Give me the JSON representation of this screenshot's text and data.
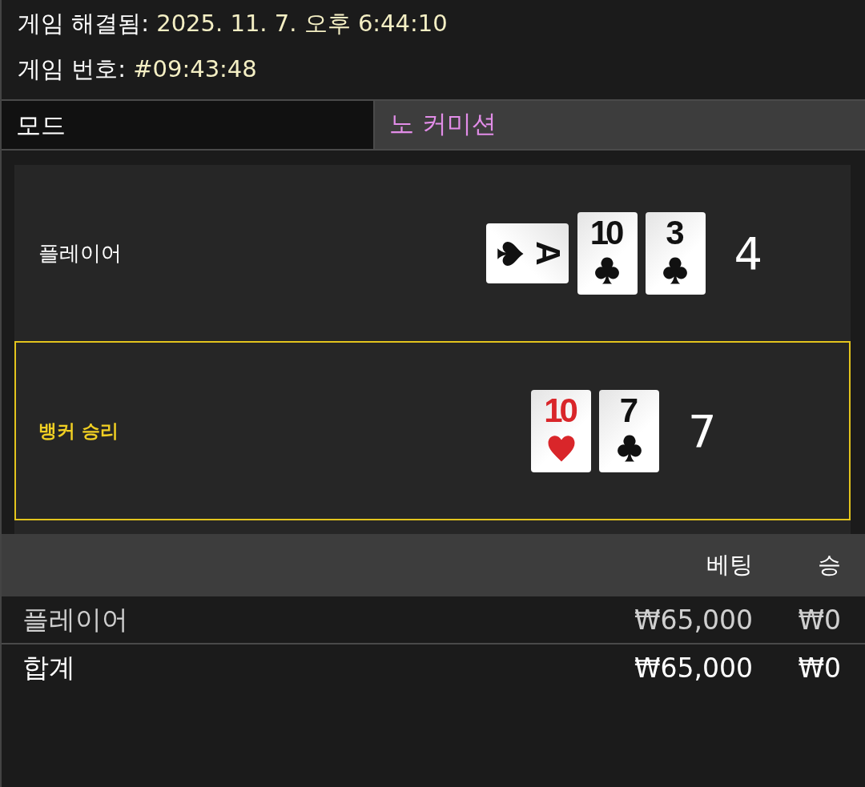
{
  "header": [
    {
      "label": "게임 해결됨:",
      "value": "2025. 11. 7. 오후 6:44:10"
    },
    {
      "label": "게임 번호:",
      "value": "#09:43:48"
    }
  ],
  "mode": {
    "label": "모드",
    "value": "노 커미션"
  },
  "hands": [
    {
      "label": "플레이어",
      "winner": false,
      "score": "4",
      "cards": [
        {
          "rank": "A",
          "kind": "spade",
          "rotated": true
        },
        {
          "rank": "10",
          "kind": "club",
          "rotated": false
        },
        {
          "rank": "3",
          "kind": "club",
          "rotated": false
        }
      ]
    },
    {
      "label": "뱅커 승리",
      "winner": true,
      "score": "7",
      "cards": [
        {
          "rank": "10",
          "kind": "heart",
          "rotated": false
        },
        {
          "rank": "7",
          "kind": "club",
          "rotated": false
        }
      ]
    }
  ],
  "bets": {
    "columns": [
      "베팅",
      "승"
    ],
    "rows": [
      {
        "kind": "line",
        "name": "플레이어",
        "bet": "₩65,000",
        "win": "₩0"
      },
      {
        "kind": "total",
        "name": "합계",
        "bet": "₩65,000",
        "win": "₩0"
      }
    ]
  }
}
